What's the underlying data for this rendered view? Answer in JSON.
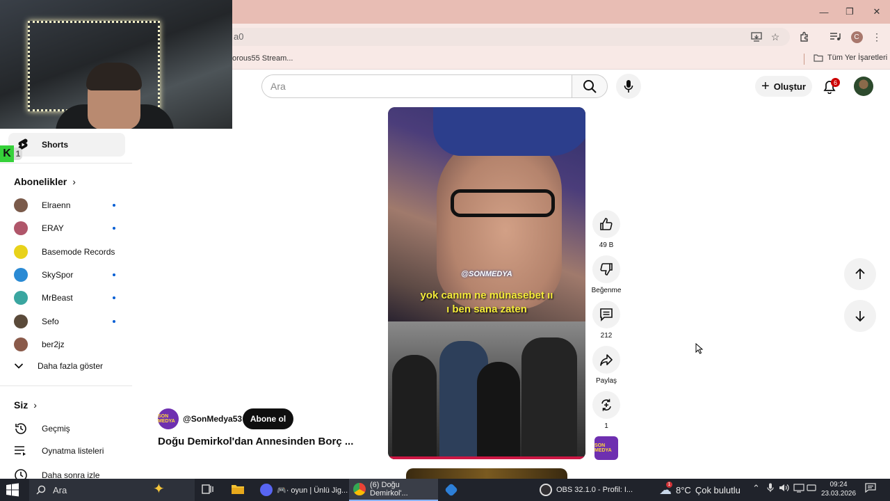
{
  "browser": {
    "url_fragment": "a0",
    "bookmark_1": "orous55 Stream...",
    "all_bookmarks": "Tüm Yer İşaretleri",
    "profile_initial": "C"
  },
  "header": {
    "search_placeholder": "Ara",
    "create_label": "Oluştur",
    "notification_count": "6"
  },
  "sidebar": {
    "shorts_label": "Shorts",
    "subscriptions_heading": "Abonelikler",
    "subscriptions": [
      {
        "name": "Elraenn",
        "color": "#7a5a4a",
        "new": true
      },
      {
        "name": "ERAY",
        "color": "#b0566a",
        "new": true
      },
      {
        "name": "Basemode Records",
        "color": "#e8d21a",
        "new": false
      },
      {
        "name": "SkySpor",
        "color": "#2a8ad4",
        "new": true
      },
      {
        "name": "MrBeast",
        "color": "#3aa6a0",
        "new": true
      },
      {
        "name": "Sefo",
        "color": "#5a4a3a",
        "new": true
      },
      {
        "name": "ber2jz",
        "color": "#8a5a4a",
        "new": false
      }
    ],
    "show_more": "Daha fazla göster",
    "you_heading": "Siz",
    "you_items": [
      "Geçmiş",
      "Oynatma listeleri",
      "Daha sonra izle"
    ]
  },
  "video": {
    "watermark": "@SONMEDYA",
    "subtitle_line1": "yok canım ne münasebet ıı",
    "subtitle_line2": "ı ben sana zaten",
    "channel_handle": "@SonMedya53",
    "channel_avatar_text": "SON MEDYA",
    "subscribe_label": "Abone ol",
    "title": "Doğu Demirkol'dan Annesinden Borç ..."
  },
  "actions": {
    "likes": "49 B",
    "dislike_label": "Beğenme",
    "comments": "212",
    "share_label": "Paylaş",
    "remix_count": "1"
  },
  "taskbar": {
    "search_placeholder": "Ara",
    "apps": [
      {
        "label": "🎮· oyun | Ünlü Jig...",
        "color": "#5865f2",
        "active": false
      },
      {
        "label": "(6) Doğu Demirkol'...",
        "color": "#4285f4",
        "active": true
      },
      {
        "label": "",
        "color": "#2d7fd8",
        "active": false
      },
      {
        "label": "OBS 32.1.0 - Profil: I...",
        "color": "#302e31",
        "active": false
      }
    ],
    "weather_temp": "8°C",
    "weather_text": "Çok bulutlu",
    "weather_alert": "1",
    "time": "09:24",
    "date": "23.03.2026"
  }
}
